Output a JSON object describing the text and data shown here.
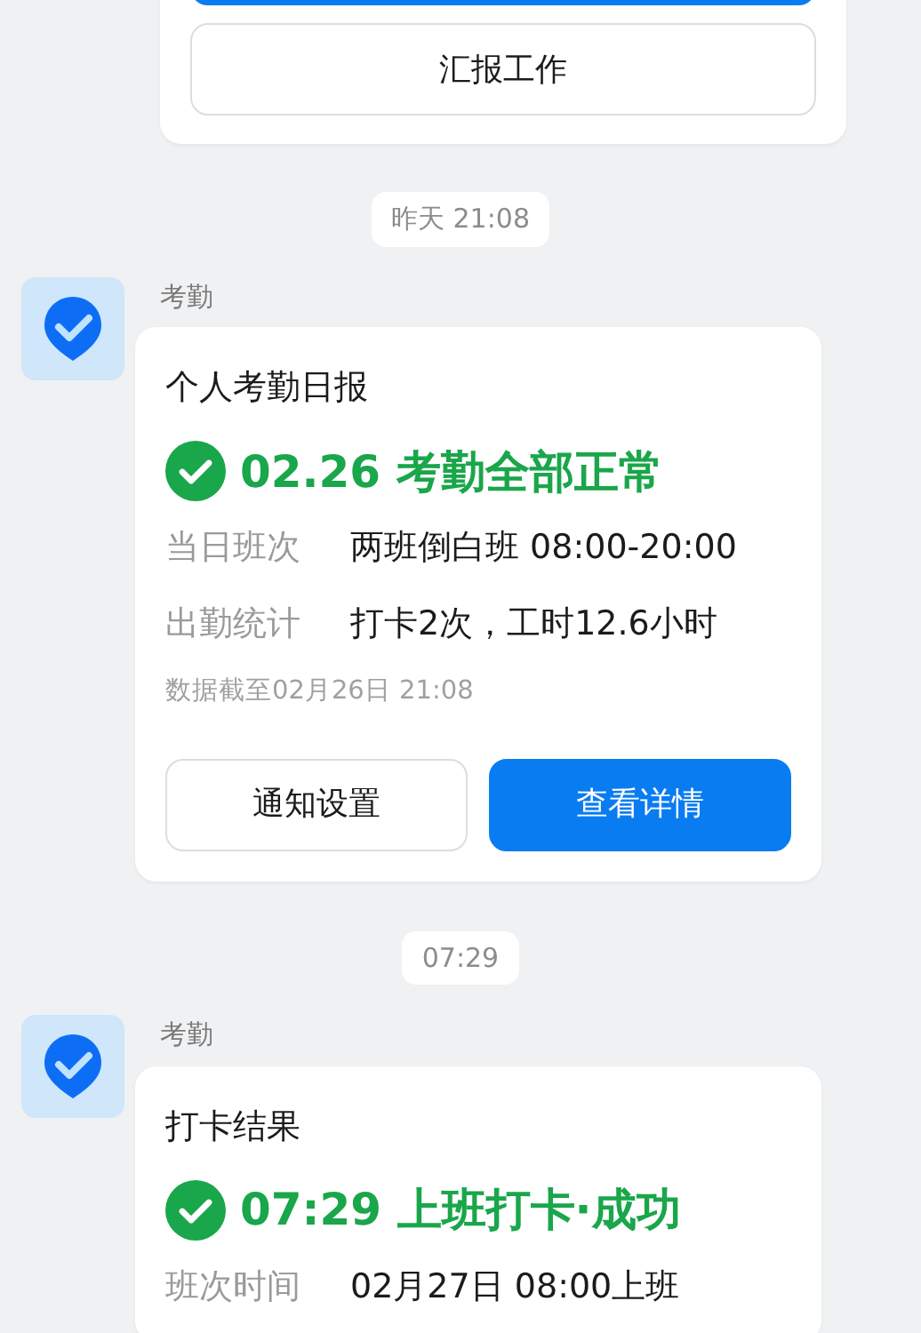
{
  "top_card": {
    "buttons": [
      {
        "kind": "primary"
      },
      {
        "kind": "secondary",
        "label": "汇报工作"
      }
    ]
  },
  "messages": [
    {
      "time": "昨天 21:08",
      "sender": "考勤",
      "card": {
        "title": "个人考勤日报",
        "status": "02.26 考勤全部正常",
        "rows": [
          {
            "label": "当日班次",
            "value": "两班倒白班 08:00-20:00"
          },
          {
            "label": "出勤统计",
            "value": "打卡2次，工时12.6小时"
          }
        ],
        "note": "数据截至02月26日 21:08",
        "buttons": [
          {
            "kind": "secondary",
            "label": "通知设置"
          },
          {
            "kind": "primary",
            "label": "查看详情"
          }
        ]
      }
    },
    {
      "time": "07:29",
      "sender": "考勤",
      "card": {
        "title": "打卡结果",
        "status": "07:29 上班打卡·成功",
        "rows": [
          {
            "label": "班次时间",
            "value": "02月27日 08:00上班"
          }
        ]
      }
    }
  ]
}
